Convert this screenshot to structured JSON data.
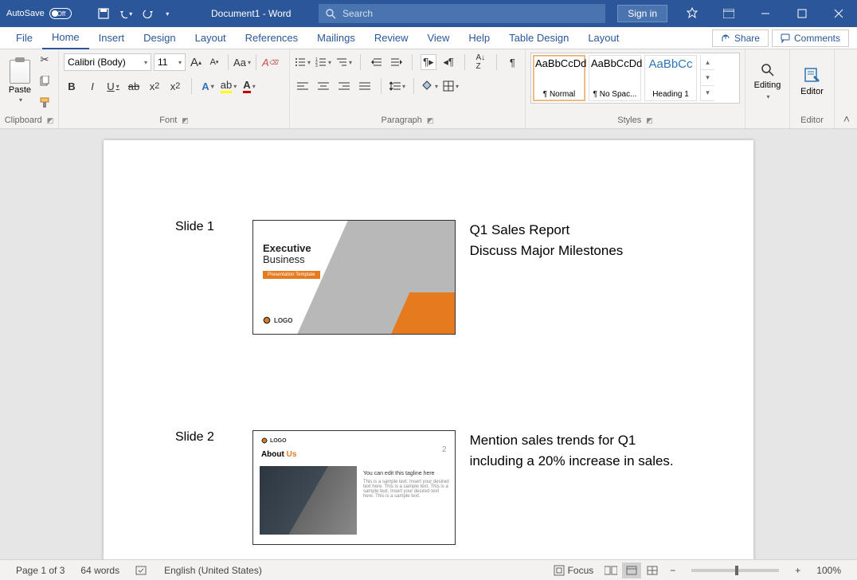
{
  "titlebar": {
    "autosave_label": "AutoSave",
    "autosave_state": "Off",
    "doc_title": "Document1 - Word",
    "search_placeholder": "Search",
    "signin": "Sign in"
  },
  "tabs": {
    "file": "File",
    "home": "Home",
    "insert": "Insert",
    "design": "Design",
    "layout": "Layout",
    "references": "References",
    "mailings": "Mailings",
    "review": "Review",
    "view": "View",
    "help": "Help",
    "table_design": "Table Design",
    "layout2": "Layout",
    "share": "Share",
    "comments": "Comments"
  },
  "ribbon": {
    "clipboard": {
      "paste": "Paste",
      "label": "Clipboard"
    },
    "font": {
      "name": "Calibri (Body)",
      "size": "11",
      "label": "Font"
    },
    "paragraph": {
      "label": "Paragraph"
    },
    "styles": {
      "label": "Styles",
      "items": [
        {
          "preview": "AaBbCcDd",
          "name": "¶ Normal"
        },
        {
          "preview": "AaBbCcDd",
          "name": "¶ No Spac..."
        },
        {
          "preview": "AaBbCc",
          "name": "Heading 1"
        }
      ]
    },
    "editing": {
      "label": "Editing"
    },
    "editor": {
      "label": "Editor"
    }
  },
  "document": {
    "slides": [
      {
        "label": "Slide 1",
        "thumb": {
          "title1": "Executive",
          "title2": "Business",
          "badge": "Presentation Template",
          "logo": "LOGO"
        },
        "text": "Q1 Sales Report\nDiscuss Major Milestones"
      },
      {
        "label": "Slide 2",
        "thumb": {
          "logo": "LOGO",
          "about": "About",
          "us": "Us",
          "page": "2",
          "tagline": "You can edit this tagline here",
          "lorem": "This is a sample text. Insert your desired text here. This is a sample text. This is a sample text. Insert your desired text here. This is a sample text."
        },
        "text": "Mention sales trends for Q1 including a 20% increase in sales."
      }
    ]
  },
  "statusbar": {
    "page": "Page 1 of 3",
    "words": "64 words",
    "lang": "English (United States)",
    "focus": "Focus",
    "zoom": "100%"
  }
}
